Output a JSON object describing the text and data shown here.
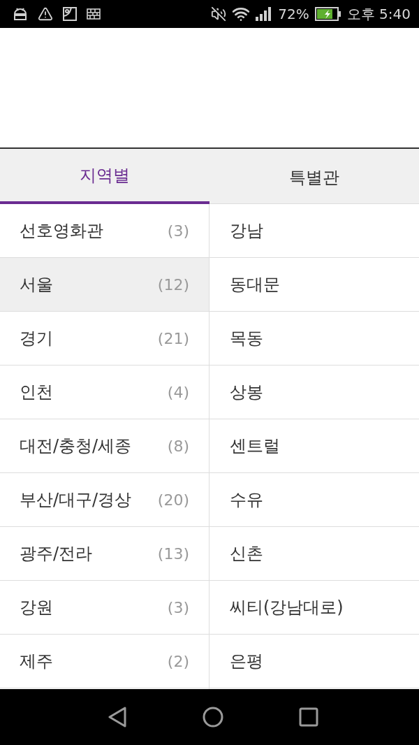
{
  "status_bar": {
    "battery_percent": "72%",
    "time": "오후 5:40"
  },
  "tabs": [
    {
      "label": "지역별",
      "selected": true
    },
    {
      "label": "특별관",
      "selected": false
    }
  ],
  "regions": [
    {
      "name": "선호영화관",
      "count": "(3)",
      "selected": false
    },
    {
      "name": "서울",
      "count": "(12)",
      "selected": true
    },
    {
      "name": "경기",
      "count": "(21)",
      "selected": false
    },
    {
      "name": "인천",
      "count": "(4)",
      "selected": false
    },
    {
      "name": "대전/충청/세종",
      "count": "(8)",
      "selected": false
    },
    {
      "name": "부산/대구/경상",
      "count": "(20)",
      "selected": false
    },
    {
      "name": "광주/전라",
      "count": "(13)",
      "selected": false
    },
    {
      "name": "강원",
      "count": "(3)",
      "selected": false
    },
    {
      "name": "제주",
      "count": "(2)",
      "selected": false
    }
  ],
  "theaters": [
    {
      "name": "강남"
    },
    {
      "name": "동대문"
    },
    {
      "name": "목동"
    },
    {
      "name": "상봉"
    },
    {
      "name": "센트럴"
    },
    {
      "name": "수유"
    },
    {
      "name": "신촌"
    },
    {
      "name": "씨티(강남대로)"
    },
    {
      "name": "은평"
    }
  ]
}
